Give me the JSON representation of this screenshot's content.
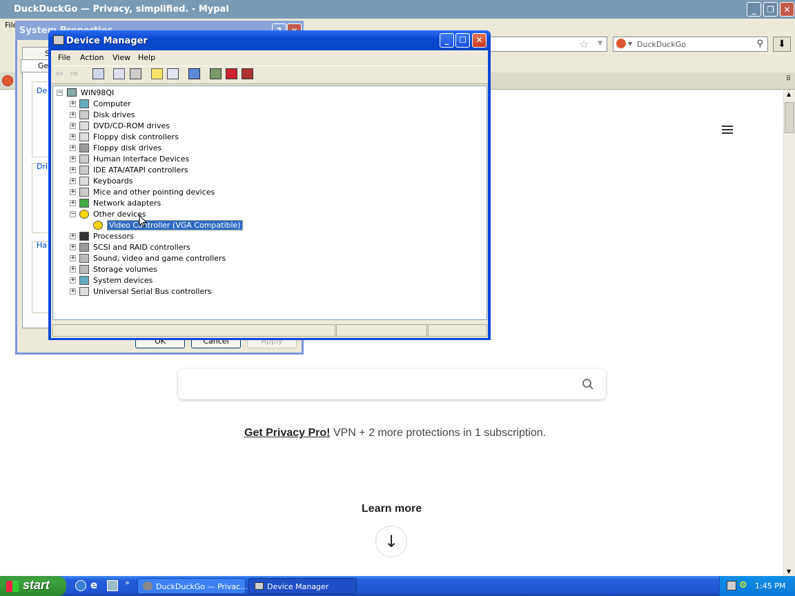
{
  "browser": {
    "title": "DuckDuckGo — Privacy, simplified. - Mypal",
    "menu_file": "File",
    "search_placeholder": "DuckDuckGo",
    "promo_link": "Get Privacy Pro!",
    "promo_text": " VPN + 2 more protections in 1 subscription.",
    "learn_more": "Learn more"
  },
  "system_properties": {
    "title": "System Properties",
    "tab_s": "S",
    "tab_ge": "Ge",
    "group_de": "De",
    "group_dri": "Dri",
    "group_ha": "Ha",
    "ok": "OK",
    "cancel": "Cancel",
    "apply": "Apply"
  },
  "device_manager": {
    "title": "Device Manager",
    "menu": [
      "File",
      "Action",
      "View",
      "Help"
    ],
    "tree_root": "WIN98QI",
    "categories": [
      {
        "label": "Computer",
        "expand": "+",
        "icon": "computer-icon"
      },
      {
        "label": "Disk drives",
        "expand": "+",
        "icon": "disk-drive-icon"
      },
      {
        "label": "DVD/CD-ROM drives",
        "expand": "+",
        "icon": "cd-drive-icon"
      },
      {
        "label": "Floppy disk controllers",
        "expand": "+",
        "icon": "floppy-controller-icon"
      },
      {
        "label": "Floppy disk drives",
        "expand": "+",
        "icon": "floppy-drive-icon"
      },
      {
        "label": "Human Interface Devices",
        "expand": "+",
        "icon": "hid-icon"
      },
      {
        "label": "IDE ATA/ATAPI controllers",
        "expand": "+",
        "icon": "ide-icon"
      },
      {
        "label": "Keyboards",
        "expand": "+",
        "icon": "keyboard-icon"
      },
      {
        "label": "Mice and other pointing devices",
        "expand": "+",
        "icon": "mouse-icon"
      },
      {
        "label": "Network adapters",
        "expand": "+",
        "icon": "network-icon"
      },
      {
        "label": "Other devices",
        "expand": "−",
        "icon": "unknown-device-icon"
      },
      {
        "label": "Video Controller (VGA Compatible)",
        "child": true,
        "icon": "warning-device-icon"
      },
      {
        "label": "Processors",
        "expand": "+",
        "icon": "processor-icon"
      },
      {
        "label": "SCSI and RAID controllers",
        "expand": "+",
        "icon": "scsi-icon"
      },
      {
        "label": "Sound, video and game controllers",
        "expand": "+",
        "icon": "sound-icon"
      },
      {
        "label": "Storage volumes",
        "expand": "+",
        "icon": "storage-icon"
      },
      {
        "label": "System devices",
        "expand": "+",
        "icon": "system-icon"
      },
      {
        "label": "Universal Serial Bus controllers",
        "expand": "+",
        "icon": "usb-icon"
      }
    ]
  },
  "taskbar": {
    "start": "start",
    "tasks": [
      "DuckDuckGo — Privac...",
      "Device Manager"
    ],
    "clock": "1:45 PM"
  }
}
